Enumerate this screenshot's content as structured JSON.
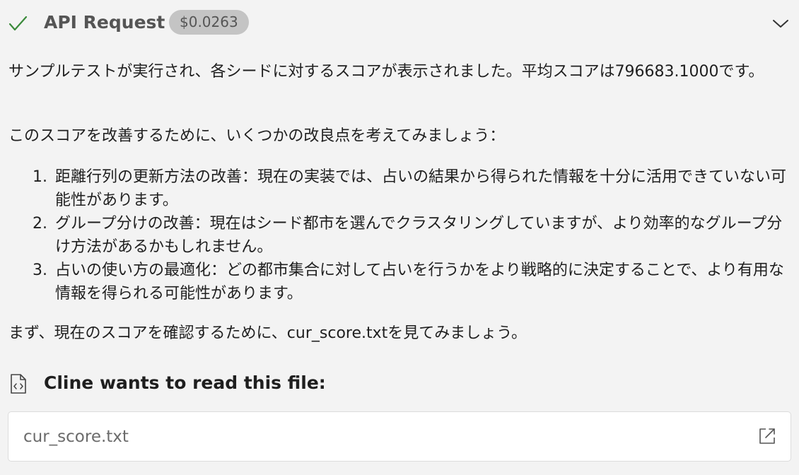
{
  "header": {
    "title": "API Request",
    "cost": "$0.0263",
    "status_icon": "check-icon",
    "toggle_icon": "chevron-down-icon",
    "check_color": "#3a8a3a"
  },
  "message": {
    "paragraph_1": "サンプルテストが実行され、各シードに対するスコアが表示されました。平均スコアは796683.1000です。",
    "paragraph_2": "このスコアを改善するために、いくつかの改良点を考えてみましょう：",
    "plan_items": [
      {
        "number": "1.",
        "text": "距離行列の更新方法の改善：現在の実装では、占いの結果から得られた情報を十分に活用できていない可能性があります。"
      },
      {
        "number": "2.",
        "text": "グループ分けの改善：現在はシード都市を選んでクラスタリングしていますが、より効率的なグループ分け方法があるかもしれません。"
      },
      {
        "number": "3.",
        "text": "占いの使い方の最適化：どの都市集合に対して占いを行うかをより戦略的に決定することで、より有用な情報を得られる可能性があります。"
      }
    ],
    "paragraph_3": "まず、現在のスコアを確認するために、cur_score.txtを見てみましょう。"
  },
  "file_request": {
    "label": "Cline wants to read this file:",
    "icon": "file-code-icon",
    "file_name": "cur_score.txt",
    "open_icon": "external-link-icon"
  }
}
